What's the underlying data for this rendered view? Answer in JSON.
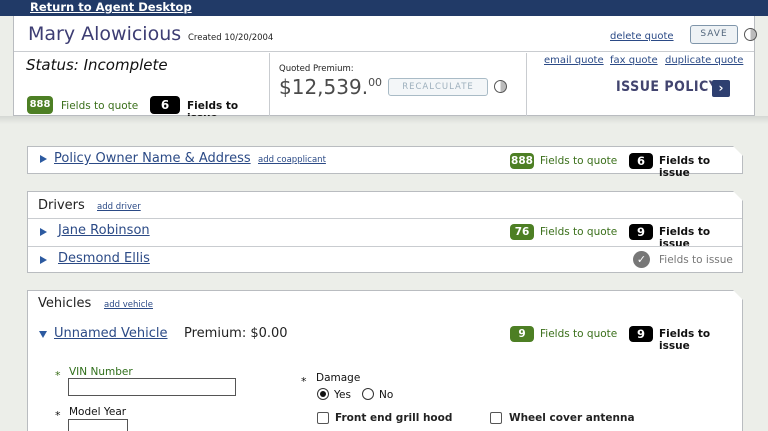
{
  "topbar": {
    "return_link": "Return to Agent Desktop"
  },
  "header": {
    "customer_name": "Mary Alowicious",
    "created": "Created 10/20/2004",
    "delete_link": "delete quote",
    "save_label": "SAVE",
    "status": "Status: Incomplete",
    "fields_to_quote_count": "888",
    "fields_to_quote_label": "Fields to quote",
    "fields_to_issue_count": "6",
    "fields_to_issue_label": "Fields to issue",
    "quoted_premium_label": "Quoted Premium:",
    "quoted_premium_main": "$12,539.",
    "quoted_premium_cents": "00",
    "recalculate_label": "RECALCULATE",
    "email_link": "email quote",
    "fax_link": "fax quote",
    "duplicate_link": "duplicate quote",
    "issue_policy_label": "ISSUE POLICY",
    "issue_policy_arrow": "›"
  },
  "policy_owner": {
    "title": "Policy Owner Name & Address",
    "add_link": "add coapplicant",
    "quote_count": "888",
    "quote_label": "Fields to quote",
    "issue_count": "6",
    "issue_label": "Fields to issue"
  },
  "drivers": {
    "title": "Drivers",
    "add_link": "add driver",
    "items": [
      {
        "name": "Jane Robinson",
        "quote_count": "76",
        "quote_label": "Fields to quote",
        "issue_count": "9",
        "issue_label": "Fields to issue"
      },
      {
        "name": "Desmond Ellis",
        "issue_label": "Fields to issue",
        "check": "✓"
      }
    ]
  },
  "vehicles": {
    "title": "Vehicles",
    "add_link": "add vehicle",
    "vehicle": {
      "name": "Unnamed Vehicle",
      "premium": "Premium: $0.00",
      "quote_count": "9",
      "quote_label": "Fields to quote",
      "issue_count": "9",
      "issue_label": "Fields to issue"
    },
    "form": {
      "vin_label": "VIN Number",
      "vin_value": "",
      "model_year_label": "Model Year",
      "model_year_value": "",
      "damage_label": "Damage",
      "damage_yes": "Yes",
      "damage_no": "No",
      "damage_selected": "Yes",
      "cb_front": "Front end grill hood",
      "cb_wheel": "Wheel cover antenna"
    },
    "required_marker": "*"
  },
  "colors": {
    "topbar": "#213a67",
    "link": "#2b4a86",
    "green_pill": "#4d7f24",
    "black_pill": "#000000",
    "name": "#3d3d73",
    "background": "#eceee9"
  }
}
